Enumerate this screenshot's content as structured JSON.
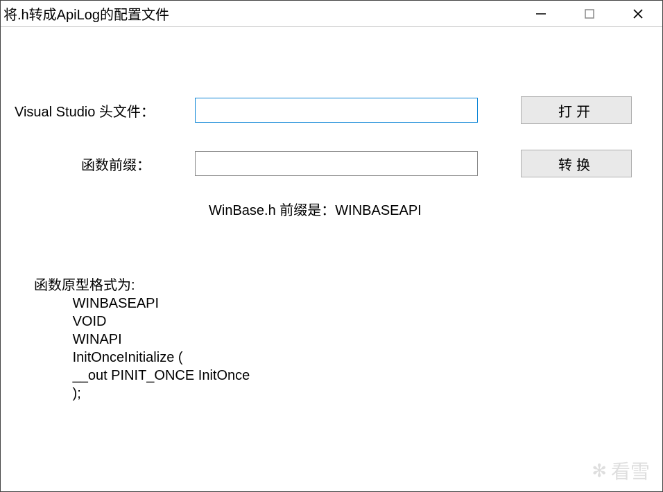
{
  "window": {
    "title": "将.h转成ApiLog的配置文件"
  },
  "form": {
    "header_label": "Visual Studio 头文件：",
    "header_value": "",
    "header_placeholder": "",
    "open_button": "打开",
    "prefix_label": "函数前缀：",
    "prefix_value": "",
    "prefix_placeholder": "",
    "convert_button": "转换",
    "hint": "WinBase.h 前缀是：WINBASEAPI"
  },
  "prototype": {
    "heading": "函数原型格式为:",
    "lines": [
      "WINBASEAPI",
      "VOID",
      "WINAPI",
      "InitOnceInitialize (",
      "__out PINIT_ONCE InitOnce",
      ");"
    ]
  },
  "watermark": "看雪"
}
